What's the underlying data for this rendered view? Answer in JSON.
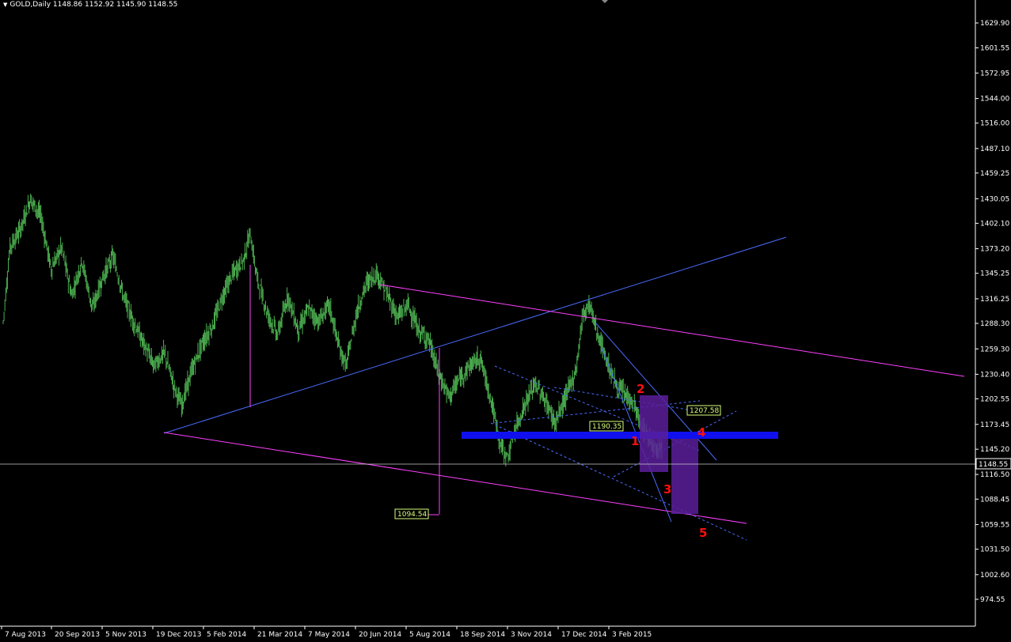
{
  "header": {
    "symbol_label": "GOLD,Daily",
    "open": "1148.86",
    "high": "1152.92",
    "low": "1145.90",
    "close": "1148.55"
  },
  "colors": {
    "background": "#000000",
    "candles": "#4caf50",
    "axis": "#ffffff",
    "trendline_blue": "#4a6cff",
    "channel_magenta": "#ff40ff",
    "support_zone": "#1010ee",
    "wave_box": "#5a1f9a",
    "wave_labels": "#ff1010",
    "price_line": "#c8c8c8",
    "label_text": "#d8ff7a"
  },
  "chart_data": {
    "type": "candlestick",
    "title": "GOLD,Daily",
    "ylim": [
      974.55,
      1650.0
    ],
    "y_ticks": [
      "1629.90",
      "1601.55",
      "1572.95",
      "1544.00",
      "1516.00",
      "1487.10",
      "1459.25",
      "1430.05",
      "1402.10",
      "1373.20",
      "1345.25",
      "1316.25",
      "1288.30",
      "1259.30",
      "1230.40",
      "1202.55",
      "1173.45",
      "1145.20",
      "1116.50",
      "1088.45",
      "1059.55",
      "1031.50",
      "1002.60",
      "974.55"
    ],
    "x_ticks": [
      "7 Aug 2013",
      "20 Sep 2013",
      "5 Nov 2013",
      "19 Dec 2013",
      "5 Feb 2014",
      "21 Mar 2014",
      "7 May 2014",
      "20 Jun 2014",
      "5 Aug 2014",
      "18 Sep 2014",
      "3 Nov 2014",
      "17 Dec 2014",
      "3 Feb 2015"
    ],
    "current_price": "1148.55",
    "price_path": [
      [
        0,
        1290
      ],
      [
        2,
        1375
      ],
      [
        5,
        1395
      ],
      [
        8,
        1430
      ],
      [
        11,
        1410
      ],
      [
        14,
        1350
      ],
      [
        17,
        1375
      ],
      [
        20,
        1320
      ],
      [
        23,
        1360
      ],
      [
        26,
        1305
      ],
      [
        29,
        1340
      ],
      [
        32,
        1365
      ],
      [
        35,
        1320
      ],
      [
        38,
        1290
      ],
      [
        41,
        1265
      ],
      [
        44,
        1240
      ],
      [
        47,
        1255
      ],
      [
        50,
        1215
      ],
      [
        52,
        1195
      ],
      [
        55,
        1235
      ],
      [
        58,
        1265
      ],
      [
        61,
        1285
      ],
      [
        64,
        1320
      ],
      [
        67,
        1345
      ],
      [
        70,
        1360
      ],
      [
        72,
        1390
      ],
      [
        74,
        1340
      ],
      [
        77,
        1300
      ],
      [
        80,
        1275
      ],
      [
        83,
        1320
      ],
      [
        86,
        1280
      ],
      [
        89,
        1305
      ],
      [
        92,
        1290
      ],
      [
        95,
        1310
      ],
      [
        98,
        1260
      ],
      [
        100,
        1240
      ],
      [
        103,
        1300
      ],
      [
        106,
        1335
      ],
      [
        109,
        1345
      ],
      [
        112,
        1320
      ],
      [
        115,
        1295
      ],
      [
        118,
        1310
      ],
      [
        121,
        1280
      ],
      [
        124,
        1270
      ],
      [
        127,
        1230
      ],
      [
        130,
        1205
      ],
      [
        133,
        1225
      ],
      [
        136,
        1240
      ],
      [
        139,
        1250
      ],
      [
        142,
        1205
      ],
      [
        145,
        1150
      ],
      [
        147,
        1135
      ],
      [
        149,
        1165
      ],
      [
        152,
        1195
      ],
      [
        155,
        1220
      ],
      [
        158,
        1200
      ],
      [
        161,
        1175
      ],
      [
        164,
        1205
      ],
      [
        167,
        1235
      ],
      [
        169,
        1300
      ],
      [
        171,
        1310
      ],
      [
        173,
        1280
      ],
      [
        176,
        1245
      ],
      [
        179,
        1215
      ],
      [
        182,
        1205
      ],
      [
        184,
        1195
      ],
      [
        186,
        1170
      ],
      [
        188,
        1160
      ],
      [
        190,
        1148
      ]
    ],
    "annotations": [
      {
        "type": "price_label",
        "value": "1207.58"
      },
      {
        "type": "price_label",
        "value": "1190.35"
      },
      {
        "type": "price_label",
        "value": "1094.54"
      }
    ],
    "wave_labels": [
      "1",
      "2",
      "3",
      "4",
      "5"
    ],
    "grid": false
  }
}
